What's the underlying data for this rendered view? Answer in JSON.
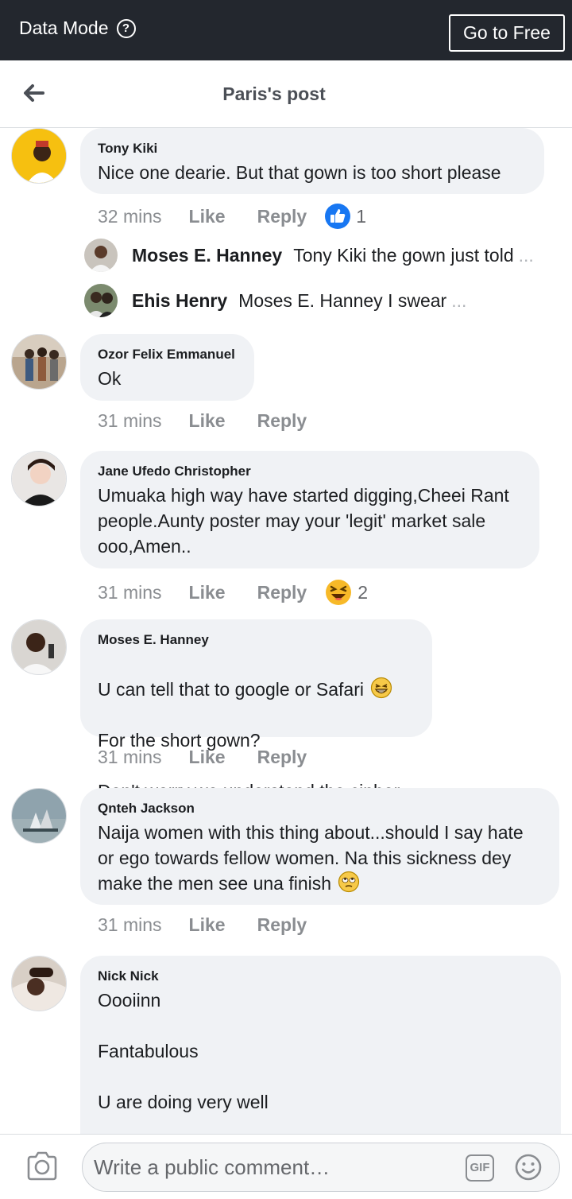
{
  "topbar": {
    "mode_label": "Data Mode",
    "help_glyph": "?",
    "go_free": "Go to Free"
  },
  "header": {
    "title": "Paris's post"
  },
  "comments": [
    {
      "name": "Tony Kiki",
      "text": "Nice one dearie. But that gown is too short please",
      "time": "32 mins",
      "like": "Like",
      "reply": "Reply",
      "reaction": "like-icon",
      "reaction_count": "1",
      "replies": [
        {
          "name": "Moses E. Hanney",
          "text": "Tony Kiki the gown just told",
          "more": "..."
        },
        {
          "name": "Ehis Henry",
          "text": "Moses E. Hanney I swear",
          "more": "..."
        }
      ]
    },
    {
      "name": "Ozor Felix Emmanuel",
      "text": "Ok",
      "time": "31 mins",
      "like": "Like",
      "reply": "Reply"
    },
    {
      "name": "Jane Ufedo Christopher",
      "text": "Umuaka high way have started digging,Cheei Rant people.Aunty poster may your 'legit' market sale ooo,Amen..",
      "time": "31 mins",
      "like": "Like",
      "reply": "Reply",
      "reaction": "laughing-emoji",
      "reaction_count": "2"
    },
    {
      "name": "Moses E. Hanney",
      "text_lines": [
        "U can tell that to google or Safari",
        "For the short gown?",
        "Don't worry we understand the cipher"
      ],
      "time": "31 mins",
      "like": "Like",
      "reply": "Reply"
    },
    {
      "name": "Qnteh Jackson",
      "text": "Naija women with this thing about...should I say hate or ego towards fellow women. Na this sickness dey make the men see una finish",
      "time": "31 mins",
      "like": "Like",
      "reply": "Reply"
    },
    {
      "name": "Nick Nick",
      "text": "Oooiinn\n\nFantabulous\n\nU are doing very well"
    }
  ],
  "composer": {
    "placeholder": "Write a public comment…",
    "gif_label": "GIF"
  },
  "colors": {
    "topbar": "#23272e",
    "bubble": "#f0f2f5",
    "like_blue": "#1877f2",
    "muted": "#8a8d91"
  }
}
